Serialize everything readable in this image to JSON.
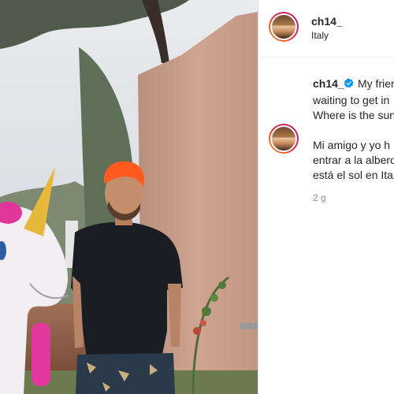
{
  "post": {
    "username": "ch14_",
    "location": "Italy"
  },
  "caption": {
    "username": "ch14_",
    "line1": "My frien",
    "line2": "waiting to get in",
    "line3": "Where is the sun",
    "line4": "Mi amigo y yo h",
    "line5": "entrar a la albero",
    "line6": "está el sol en Ita",
    "timestamp": "2 g"
  },
  "icons": {
    "verified": "verified-badge-icon",
    "avatar": "profile-avatar"
  },
  "colors": {
    "verified_blue": "#0095f6",
    "hair_orange": "#ff5a1f"
  }
}
